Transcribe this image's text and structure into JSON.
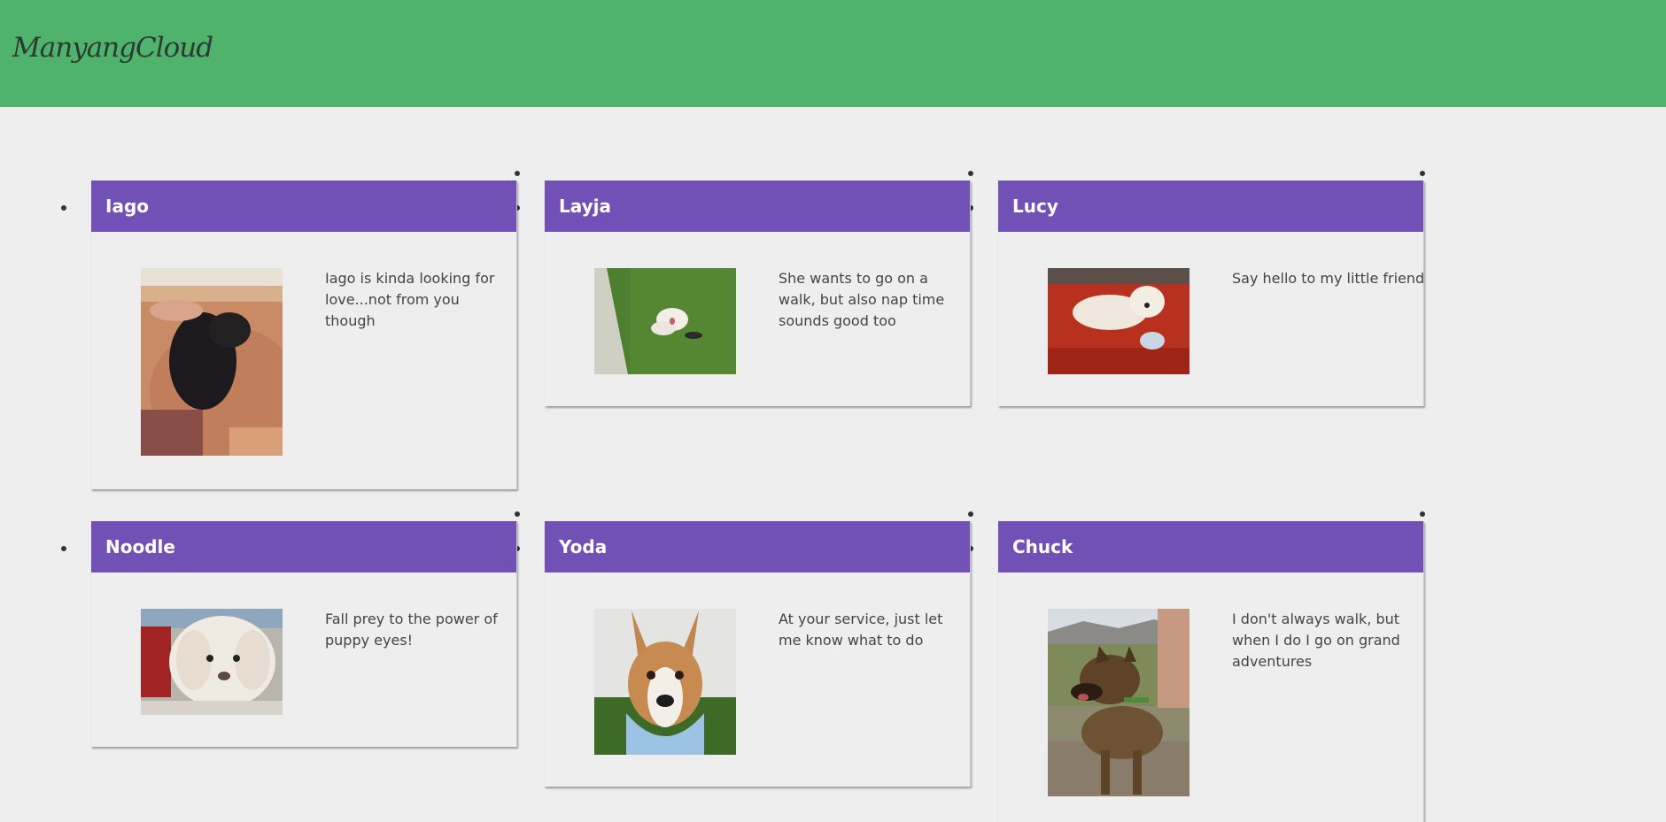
{
  "header": {
    "brand": "ManyangCloud",
    "color": "#4fb36e"
  },
  "pets": [
    {
      "name": "Iago",
      "description": "Iago is kinda looking for love...not from you though",
      "photo_icon": "black-puppy-photo"
    },
    {
      "name": "Layja",
      "description": "She wants to go on a walk, but also nap time sounds good too",
      "photo_icon": "white-dog-on-grass-photo"
    },
    {
      "name": "Lucy",
      "description": "Say hello to my little friend",
      "photo_icon": "white-dog-on-red-rug-photo"
    },
    {
      "name": "Noodle",
      "description": "Fall prey to the power of puppy eyes!",
      "photo_icon": "fluffy-white-dog-photo"
    },
    {
      "name": "Yoda",
      "description": "At your service, just let me know what to do",
      "photo_icon": "dog-with-blue-bandana-photo"
    },
    {
      "name": "Chuck",
      "description": "I don't always walk, but when I do I go on grand adventures",
      "photo_icon": "german-shepherd-outdoors-photo"
    }
  ],
  "colors": {
    "card_header": "#7151b5",
    "background": "#eeeeee"
  }
}
